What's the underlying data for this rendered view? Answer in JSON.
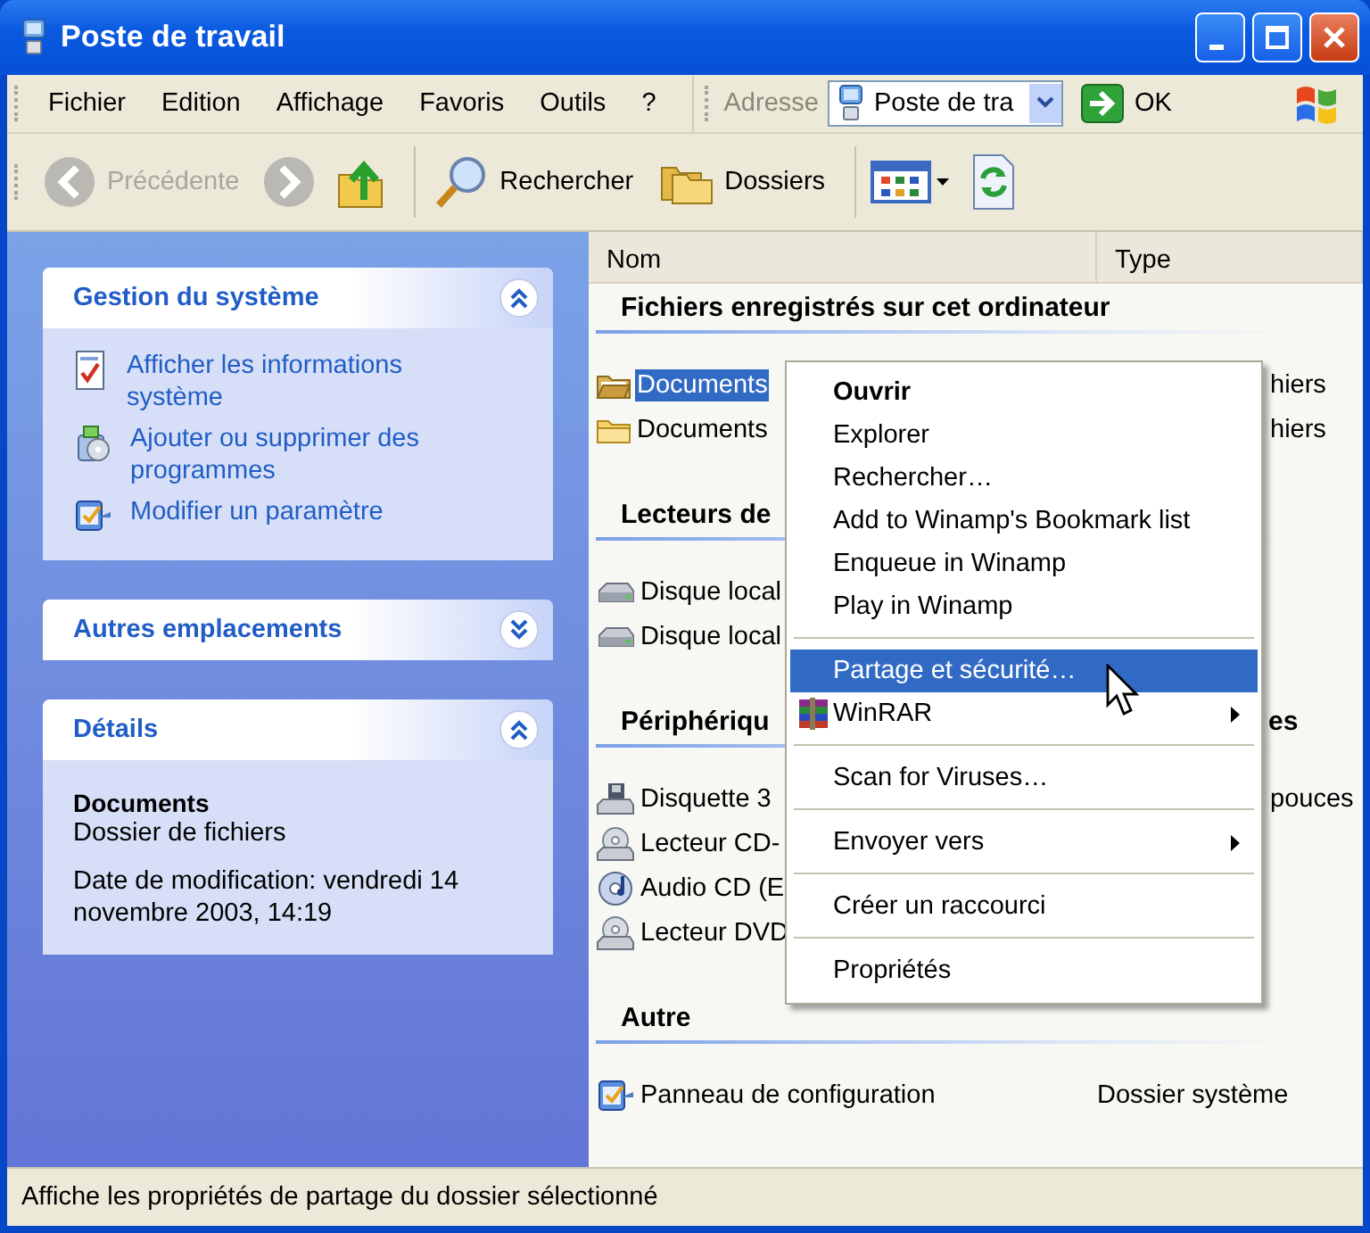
{
  "window": {
    "title": "Poste de travail"
  },
  "menu_bar": [
    "Fichier",
    "Edition",
    "Affichage",
    "Favoris",
    "Outils",
    "?"
  ],
  "address": {
    "label": "Adresse",
    "value": "Poste de tra",
    "go": "OK"
  },
  "toolbar": [
    {
      "kind": "back",
      "label": "Précédente",
      "disabled": true
    },
    {
      "kind": "forward",
      "disabled": true
    },
    {
      "kind": "up",
      "disabled": false
    },
    {
      "kind": "search",
      "label": "Rechercher",
      "disabled": false
    },
    {
      "kind": "folders",
      "label": "Dossiers",
      "disabled": false
    },
    {
      "kind": "views"
    },
    {
      "kind": "sync"
    }
  ],
  "sidebar": [
    {
      "kind": "tasks",
      "title": "Gestion du système",
      "expanded": true,
      "links": [
        {
          "kind": "info",
          "label": "Afficher les informations système"
        },
        {
          "kind": "programs",
          "label": "Ajouter ou supprimer des programmes"
        },
        {
          "kind": "settings",
          "label": "Modifier un paramètre"
        }
      ]
    },
    {
      "kind": "tasks",
      "title": "Autres emplacements",
      "expanded": false
    },
    {
      "kind": "details",
      "title": "Détails",
      "expanded": true,
      "name": "Documents",
      "type": "Dossier de fichiers",
      "modified": "Date de modification: vendredi 14 novembre 2003, 14:19"
    }
  ],
  "columns": [
    "Nom",
    "Type"
  ],
  "groups": [
    {
      "title": "Fichiers enregistrés sur cet ordinateur",
      "items": [
        {
          "kind": "folder-open",
          "name": "Documents",
          "type": "hiers",
          "selected": true
        },
        {
          "kind": "folder",
          "name": "Documents",
          "type": "hiers",
          "selected": false
        }
      ]
    },
    {
      "title": "Lecteurs de",
      "items": [
        {
          "kind": "drive",
          "name": "Disque local",
          "selected": false
        },
        {
          "kind": "drive",
          "name": "Disque local",
          "selected": false
        }
      ]
    },
    {
      "title": "Périphériqu",
      "title_end": "es",
      "items": [
        {
          "kind": "floppy",
          "name": "Disquette 3",
          "type": "pouces",
          "selected": false
        },
        {
          "kind": "cd",
          "name": "Lecteur CD-",
          "selected": false
        },
        {
          "kind": "audio",
          "name": "Audio CD (E",
          "selected": false
        },
        {
          "kind": "cd",
          "name": "Lecteur DVD",
          "selected": false
        }
      ]
    },
    {
      "title": "Autre",
      "items": [
        {
          "kind": "control",
          "name": "Panneau de configuration",
          "type": "Dossier système",
          "selected": false
        }
      ]
    }
  ],
  "context_menu": [
    {
      "kind": "command",
      "label": "Ouvrir",
      "default": true,
      "selected": false
    },
    {
      "kind": "command",
      "label": "Explorer",
      "selected": false
    },
    {
      "kind": "command",
      "label": "Rechercher…",
      "selected": false
    },
    {
      "kind": "command",
      "label": "Add to Winamp's Bookmark list",
      "selected": false
    },
    {
      "kind": "command",
      "label": "Enqueue in Winamp",
      "selected": false
    },
    {
      "kind": "command",
      "label": "Play in Winamp",
      "selected": false
    },
    {
      "kind": "separator"
    },
    {
      "kind": "command",
      "label": "Partage et sécurité…",
      "selected": true
    },
    {
      "kind": "app",
      "label": "WinRAR",
      "submenu": true,
      "selected": false
    },
    {
      "kind": "separator"
    },
    {
      "kind": "command",
      "label": "Scan for Viruses…",
      "selected": false
    },
    {
      "kind": "separator"
    },
    {
      "kind": "command",
      "label": "Envoyer vers",
      "submenu": true,
      "selected": false
    },
    {
      "kind": "separator"
    },
    {
      "kind": "command",
      "label": "Créer un raccourci",
      "selected": false
    },
    {
      "kind": "separator"
    },
    {
      "kind": "command",
      "label": "Propriétés",
      "selected": false
    }
  ],
  "status_bar": "Affiche les propriétés de partage du dossier sélectionné"
}
